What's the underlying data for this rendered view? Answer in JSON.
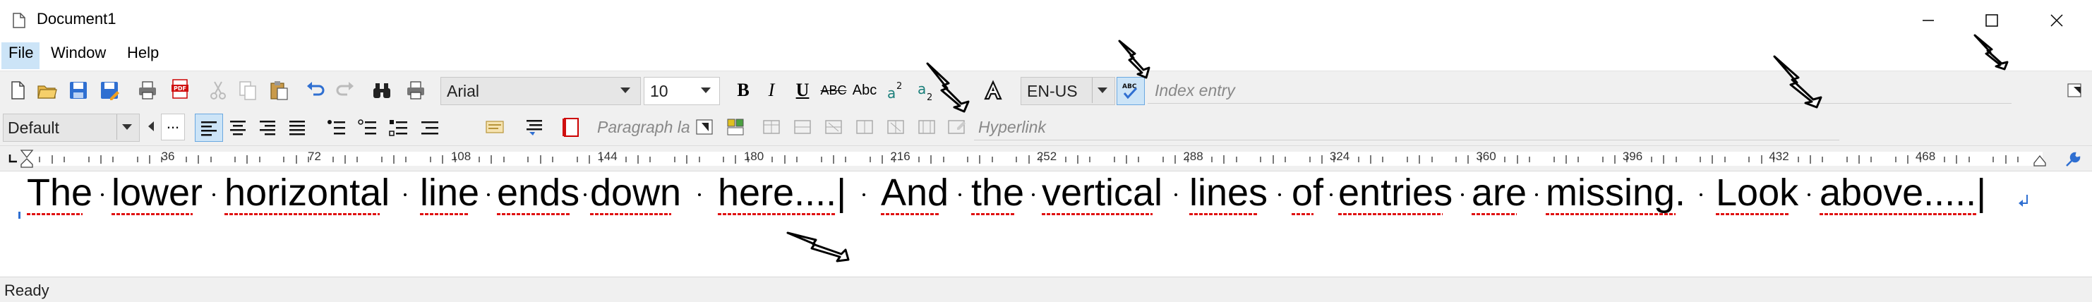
{
  "window": {
    "title": "Document1",
    "title_icon": "document-icon"
  },
  "menu": [
    {
      "label": "File"
    },
    {
      "label": "Window"
    },
    {
      "label": "Help"
    }
  ],
  "toolbar1": {
    "font_name": "Arial",
    "font_size": "10",
    "language": "EN-US",
    "index_placeholder": "Index entry"
  },
  "toolbar2": {
    "style": "Default",
    "more": "...",
    "paragraph_placeholder": "Paragraph la",
    "hyperlink_placeholder": "Hyperlink"
  },
  "ruler": {
    "marks": [
      "36",
      "72",
      "108",
      "144",
      "180",
      "216",
      "252",
      "288",
      "324",
      "360",
      "396",
      "432",
      "468"
    ]
  },
  "document": {
    "words": [
      "The",
      "lower",
      "horizontal",
      "line",
      "ends",
      "down",
      "here....|",
      "And",
      "the",
      "vertical",
      "lines",
      "of",
      "entries",
      "are",
      "missing.",
      "Look",
      "above.....|"
    ]
  },
  "status": {
    "text": "Ready"
  },
  "colors": {
    "accent": "#2f6fd1",
    "spell": "#e01010",
    "toolbar_bg": "#f0f0f0"
  }
}
